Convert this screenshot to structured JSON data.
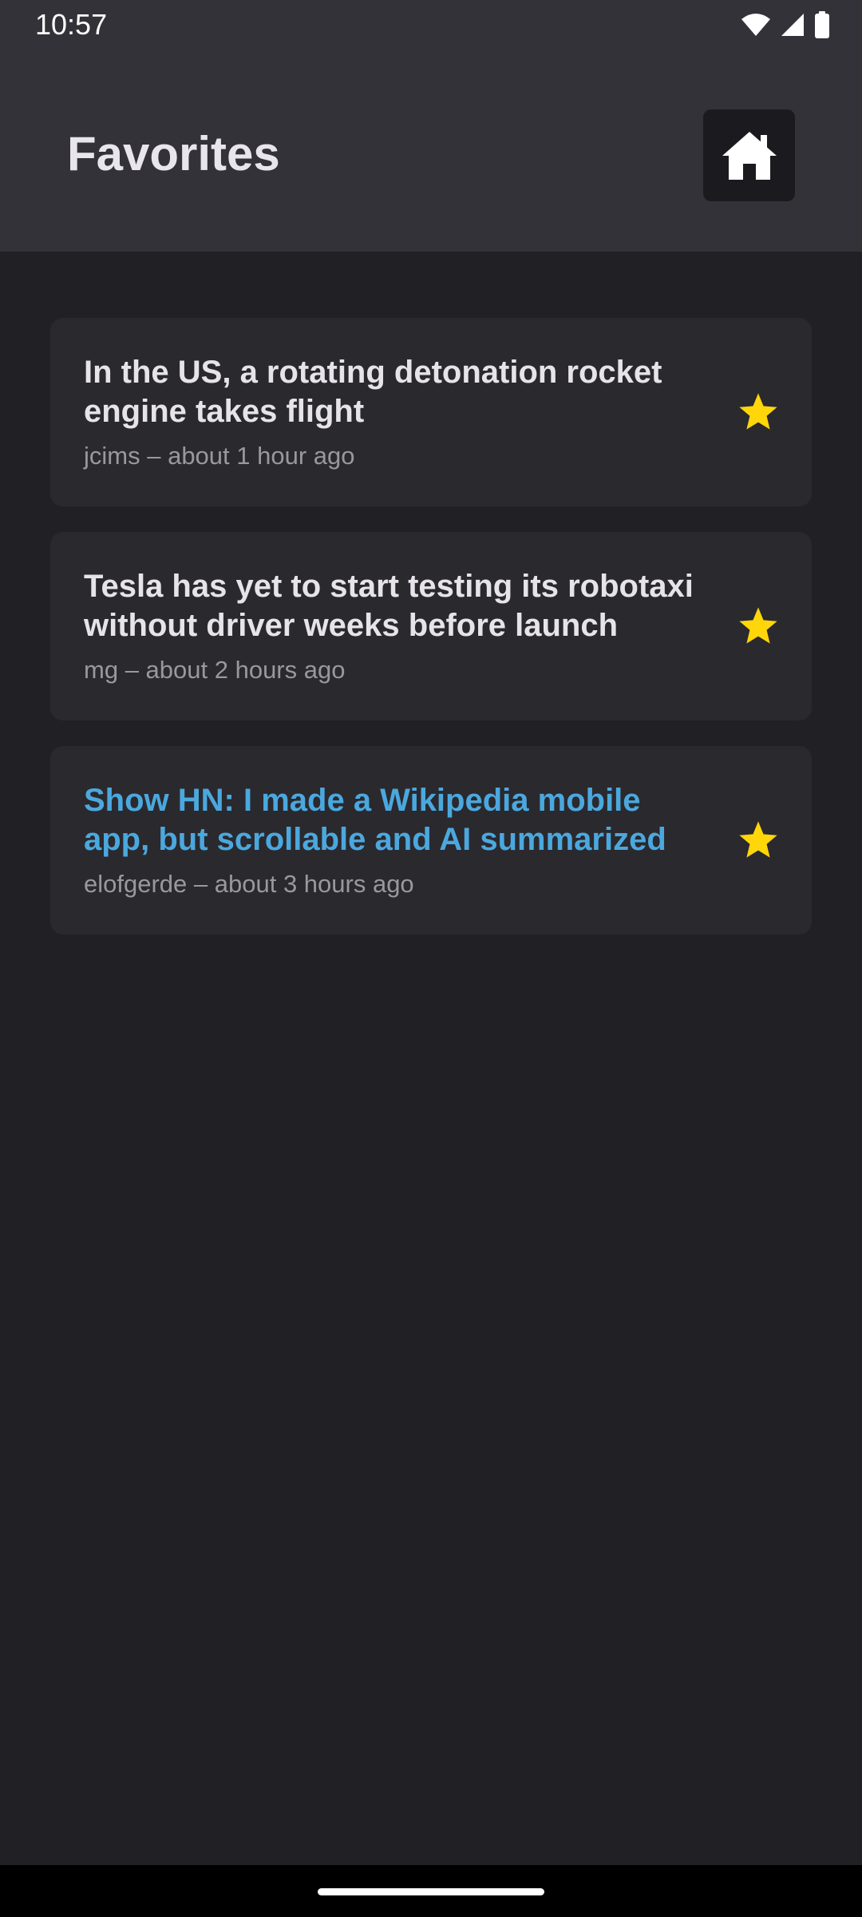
{
  "status_bar": {
    "time": "10:57",
    "icons": [
      "wifi-icon",
      "signal-icon",
      "battery-icon"
    ]
  },
  "app_bar": {
    "title": "Favorites",
    "home_icon": "home-icon"
  },
  "favorites": [
    {
      "title": "In the US, a rotating detonation rocket engine takes flight",
      "author": "jcims",
      "separator": " – ",
      "time": "about 1 hour ago",
      "visited": false,
      "starred": true
    },
    {
      "title": "Tesla has yet to start testing its robotaxi without driver weeks before launch",
      "author": "mg",
      "separator": " – ",
      "time": "about 2 hours ago",
      "visited": false,
      "starred": true
    },
    {
      "title": "Show HN: I made a Wikipedia mobile app, but scrollable and AI summarized",
      "author": "elofgerde",
      "separator": " – ",
      "time": "about 3 hours ago",
      "visited": true,
      "starred": true
    }
  ],
  "colors": {
    "background": "#212025",
    "app_bar": "#333239",
    "card": "#2a292e",
    "title_text": "#e6e4ea",
    "visited_link": "#4ba8de",
    "meta_text": "#9a989f",
    "star": "#ffd60a"
  }
}
